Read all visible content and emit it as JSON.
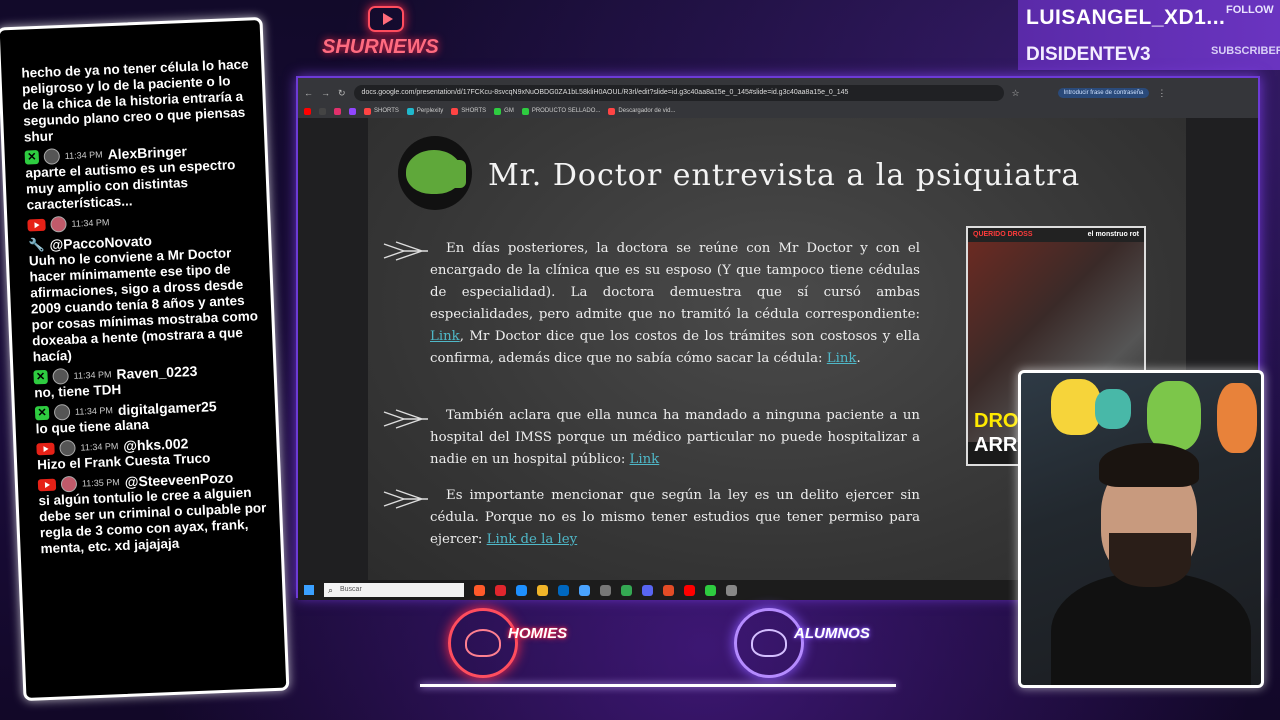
{
  "overlay": {
    "subscriber_name_1": "LUISANGEL_XD1...",
    "subscriber_label_1": "FOLLOW",
    "subscriber_name_2": "DISIDENTEV3",
    "subscriber_label_2": "SUBSCRIBER",
    "logo_text": "SHURNEWS",
    "badge_left": "HOMIES",
    "badge_right": "ALUMNOS"
  },
  "chat": {
    "messages": [
      {
        "text": "hecho de ya no tener célula lo hace peligroso y lo de la paciente o lo de la chica de la historia entraría a segundo plano creo o que piensas shur"
      },
      {
        "badge": "green",
        "time": "11:34 PM",
        "user": "AlexBringer",
        "text": "aparte el autismo es un espectro muy amplio con distintas características..."
      },
      {
        "badge": "red",
        "time": "11:34 PM",
        "user": "@PaccoNovato",
        "text": "Uuh no le conviene a Mr Doctor hacer mínimamente ese tipo de afirmaciones, sigo a dross desde 2009 cuando tenía 8 años y antes por cosas mínimas mostraba como doxeaba a hente (mostrara a que hacía)"
      },
      {
        "badge": "green",
        "time": "11:34 PM",
        "user": "Raven_0223",
        "text": "no, tiene TDH"
      },
      {
        "badge": "green",
        "time": "11:34 PM",
        "user": "digitalgamer25",
        "text": "lo que tiene alana"
      },
      {
        "badge": "red",
        "time": "11:34 PM",
        "user": "@hks.002",
        "text": "Hizo el Frank Cuesta Truco"
      },
      {
        "badge": "red",
        "time": "11:35 PM",
        "user": "@SteeveenPozo",
        "text": "si algún tontulio le cree a alguien debe ser un criminal o culpable por regla de 3 como con ayax, frank, menta, etc. xd jajajaja"
      }
    ]
  },
  "browser": {
    "url": "docs.google.com/presentation/d/17FCKcu-8svcqN9xNuOBDG0ZA1bL58kliH0AOUL/R3rl/edit?slide=id.g3c40aa8a15e_0_145#slide=id.g3c40aa8a15e_0_145",
    "password_chip": "Introducir frase de contraseña",
    "bookmarks": [
      "SHORTS",
      "Perplexity",
      "SHORTS",
      "GM",
      "PRODUCTO SELLADO...",
      "Descargador de vid..."
    ],
    "taskbar_search": "Buscar"
  },
  "slide": {
    "title": "Mr. Doctor entrevista a la psiquiatra",
    "p1": {
      "a": "En días posteriores, la doctora se reúne con Mr Doctor y con el encargado de la clínica que es su esposo (Y que tampoco tiene cédulas de especialidad). La doctora demuestra que sí cursó ambas especialidades, pero admite que no tramitó la cédula correspondiente: ",
      "link1": "Link",
      "b": ", Mr Doctor dice que los costos de los trámites son costosos y ella confirma, además dice que no sabía cómo sacar la cédula: ",
      "link2": "Link",
      "c": "."
    },
    "p2": {
      "a": "También aclara que ella nunca ha mandado a ninguna paciente a un hospital del IMSS porque un médico particular no puede hospitalizar a nadie en un hospital público: ",
      "link": "Link"
    },
    "p3": {
      "a": "Es importante mencionar que según la ley es un delito ejercer sin cédula. Porque no es lo mismo tener estudios que tener permiso para ejercer: ",
      "link": "Link de la ley"
    },
    "thumbnail": {
      "top_left": "QUERIDO DROSS",
      "top_right": "el monstruo rot",
      "big1": "DRO",
      "big2": "ARR"
    }
  }
}
